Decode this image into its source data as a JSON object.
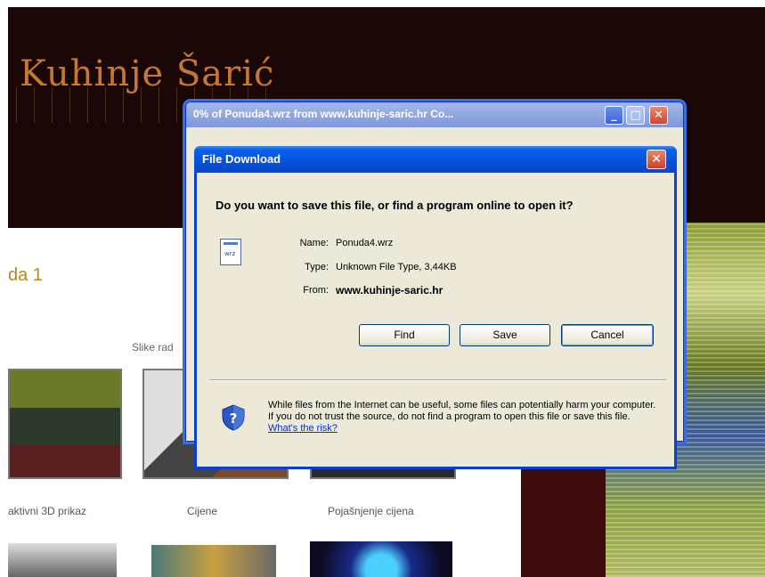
{
  "website": {
    "logo": "Kuhinje Šarić",
    "heading": "da 1",
    "gallery_label": "Slike rad",
    "captions": [
      "aktivni 3D prikaz",
      "Cijene",
      "Pojašnjenje cijena"
    ]
  },
  "progress_window": {
    "title": "0% of Ponuda4.wrz from www.kuhinje-saric.hr Co...",
    "min_icon": "minimize-icon",
    "max_icon": "maximize-icon",
    "close_icon": "close-icon"
  },
  "dialog": {
    "title": "File Download",
    "close_glyph": "✕",
    "question": "Do you want to save this file, or find a program online to open it?",
    "file_icon": "document-icon",
    "file_icon_text": "wrz",
    "fields": {
      "name_label": "Name:",
      "name_value": "Ponuda4.wrz",
      "type_label": "Type:",
      "type_value": "Unknown File Type, 3,44KB",
      "from_label": "From:",
      "from_value": "www.kuhinje-saric.hr"
    },
    "buttons": {
      "find": "Find",
      "save": "Save",
      "cancel": "Cancel"
    },
    "warning_text": "While files from the Internet can be useful, some files can potentially harm your computer. If you do not trust the source, do not find a program to open this file or save this file.",
    "risk_link": "What's the risk?",
    "shield_icon": "shield-question-icon"
  },
  "colors": {
    "title_blue": "#0552db",
    "dialog_bg": "#ece9d8",
    "link": "#0033cc",
    "logo": "#c9762f"
  }
}
